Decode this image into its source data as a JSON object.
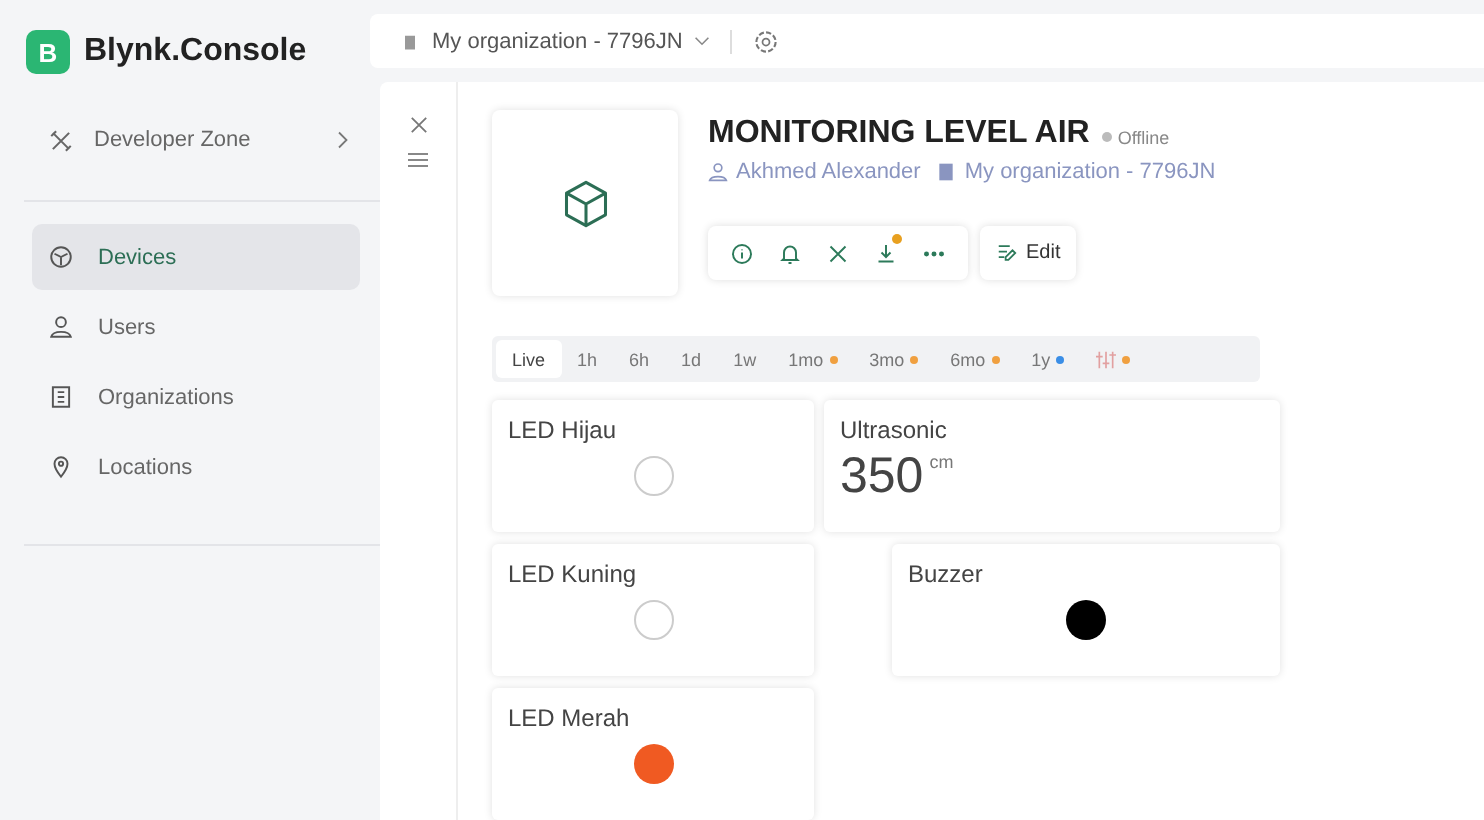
{
  "brand": {
    "logo_letter": "B",
    "name": "Blynk.Console"
  },
  "top_bar": {
    "organization": "My organization - 7796JN"
  },
  "sidebar": {
    "developer_zone": "Developer Zone",
    "items": [
      {
        "label": "Devices",
        "selected": true
      },
      {
        "label": "Users",
        "selected": false
      },
      {
        "label": "Organizations",
        "selected": false
      },
      {
        "label": "Locations",
        "selected": false
      }
    ]
  },
  "device": {
    "title": "MONITORING LEVEL AIR",
    "status": "Offline",
    "owner": "Akhmed Alexander",
    "organization": "My organization - 7796JN",
    "edit_label": "Edit",
    "actions": [
      {
        "badge": false
      },
      {
        "badge": false
      },
      {
        "badge": false
      },
      {
        "badge": true
      },
      {
        "badge": false
      }
    ]
  },
  "time_ranges": [
    {
      "label": "Live",
      "selected": true
    },
    {
      "label": "1h",
      "selected": false
    },
    {
      "label": "6h",
      "selected": false
    },
    {
      "label": "1d",
      "selected": false
    },
    {
      "label": "1w",
      "selected": false
    },
    {
      "label": "1mo",
      "selected": false,
      "color": "#f0a040"
    },
    {
      "label": "3mo",
      "selected": false,
      "color": "#f0a040"
    },
    {
      "label": "6mo",
      "selected": false,
      "color": "#f0a040"
    },
    {
      "label": "1y",
      "selected": false,
      "color": "#3a8ee6"
    },
    {
      "selected": false,
      "color": "#f0a040"
    }
  ],
  "widgets": [
    {
      "kind": "led",
      "title": "LED Hijau",
      "on": false
    },
    {
      "kind": "value",
      "title": "Ultrasonic",
      "value": "350",
      "unit": "cm"
    },
    {
      "kind": "led",
      "title": "LED Kuning",
      "on": false
    },
    {
      "kind": "led",
      "title": "Buzzer",
      "on": true,
      "color": "#000000"
    },
    {
      "kind": "led",
      "title": "LED Merah",
      "on": true,
      "color": "#f05a22"
    }
  ]
}
